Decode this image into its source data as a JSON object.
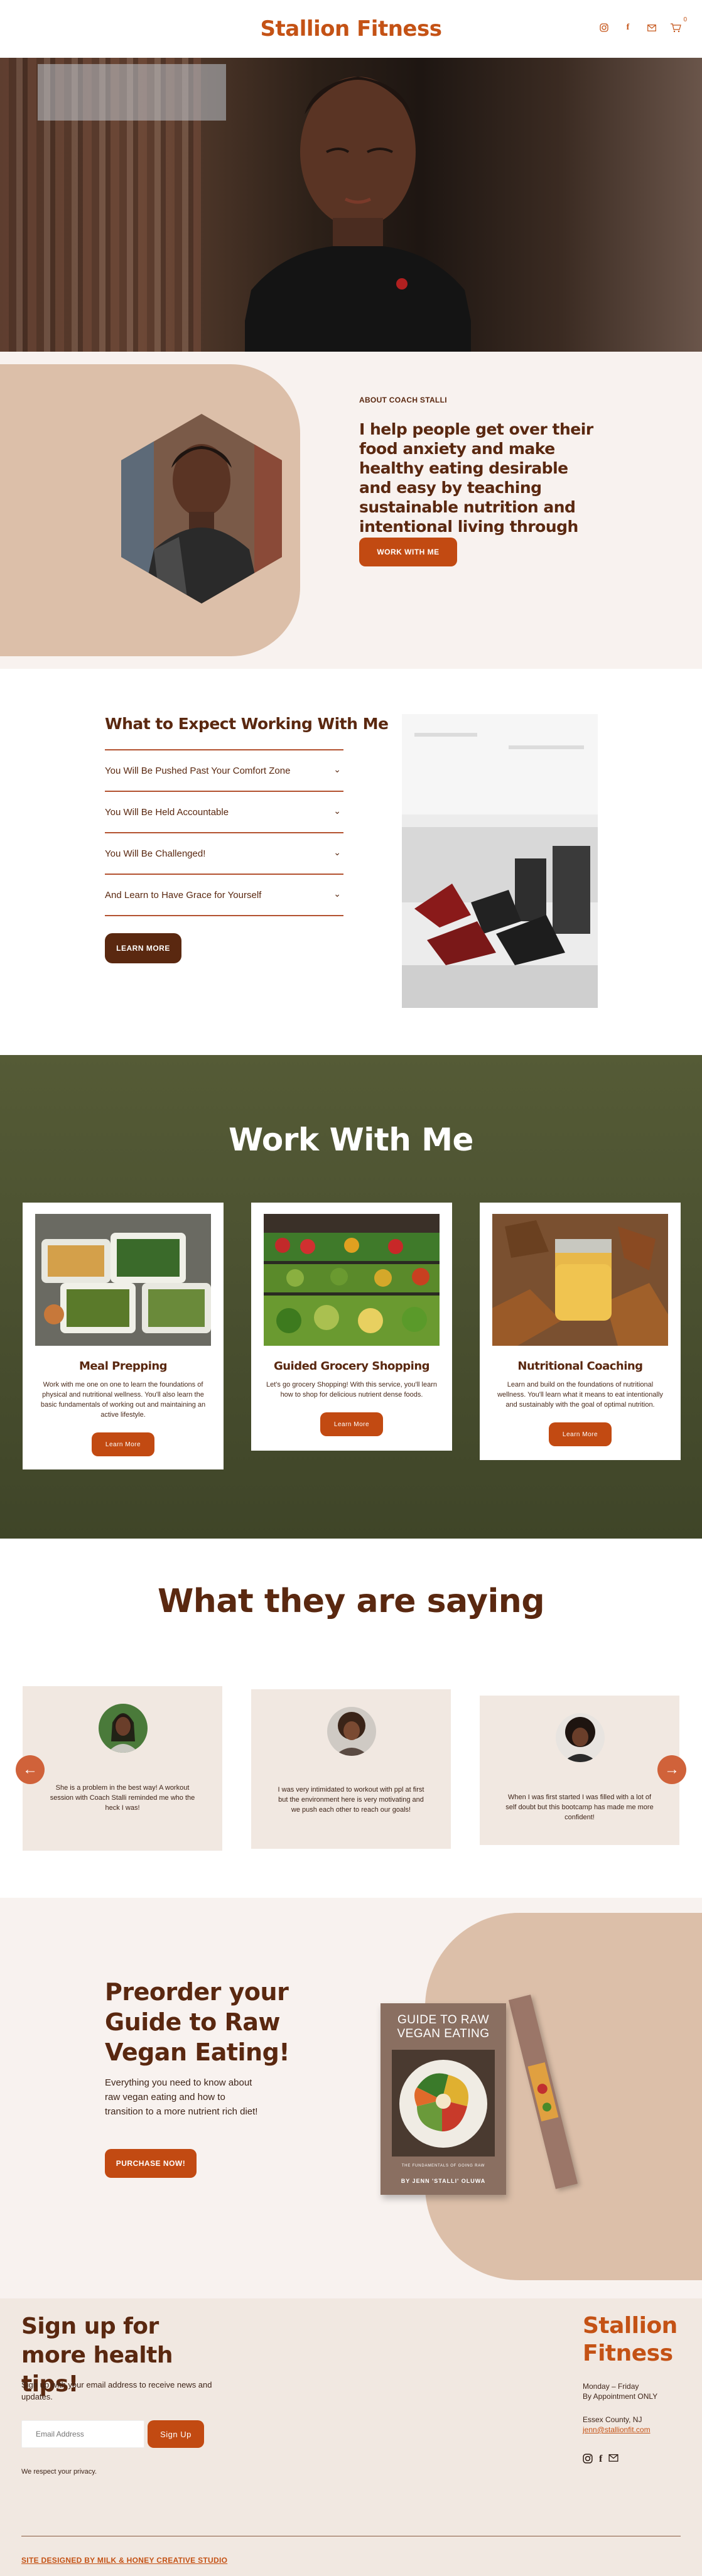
{
  "header": {
    "brand": "Stallion Fitness",
    "icons": [
      "instagram-icon",
      "facebook-icon",
      "mail-icon",
      "cart-icon"
    ],
    "cart_count": "0"
  },
  "about": {
    "kicker": "ABOUT COACH STALLI",
    "text": "I help people get over their food anxiety and make healthy eating desirable and easy by teaching sustainable nutrition and intentional living through fitness!",
    "button": "WORK WITH ME"
  },
  "expect": {
    "title": "What to Expect Working With Me",
    "items": [
      "You Will Be Pushed Past Your Comfort Zone",
      "You Will Be Held Accountable",
      "You Will Be Challenged!",
      "And Learn to Have Grace for Yourself"
    ],
    "button": "LEARN MORE"
  },
  "work": {
    "title": "Work With Me",
    "cards": [
      {
        "title": "Meal Prepping",
        "desc": "Work with me one on one to learn the foundations of physical and nutritional wellness. You'll also learn the basic fundamentals of working out and maintaining an active lifestyle.",
        "button": "Learn More"
      },
      {
        "title": "Guided Grocery Shopping",
        "desc": "Let's go grocery Shopping! With this service, you'll learn how to shop for delicious nutrient dense foods.",
        "button": "Learn More"
      },
      {
        "title": "Nutritional Coaching",
        "desc": "Learn and build on the foundations of nutritional wellness. You'll learn what it means to eat intentionally and sustainably with the goal of optimal nutrition.",
        "button": "Learn More"
      }
    ]
  },
  "testimonials": {
    "title": "What they are saying",
    "quotes": [
      "She is a problem in the best way! A workout session with Coach Stalli reminded me who the heck I was!",
      "I was very intimidated to workout with ppl at first but the environment here is very motivating and we push each other to reach our goals!",
      "When I was first started I was filled with a lot of self doubt but this bootcamp has made me more confident!"
    ],
    "prev": "←",
    "next": "→"
  },
  "preorder": {
    "title": "Preorder your Guide to Raw Vegan Eating!",
    "text": "Everything you need to know about raw vegan eating and how to transition to a more nutrient rich diet!",
    "button": "PURCHASE NOW!",
    "book_title": "GUIDE TO RAW VEGAN EATING",
    "book_subtitle": "THE FUNDAMENTALS OF GOING RAW",
    "book_author": "BY JENN 'STALLI' OLUWA"
  },
  "footer": {
    "signup_title": "Sign up for more health tips!",
    "signup_text": "Sign up with your email address to receive news and updates.",
    "email_placeholder": "Email Address",
    "signup_button": "Sign Up",
    "privacy": "We respect your privacy.",
    "brand": "Stallion Fitness",
    "hours_days": "Monday – Friday",
    "hours_note": "By Appointment ONLY",
    "location": "Essex County, NJ",
    "email": "jenn@stallionfit.com",
    "credit": "SITE DESIGNED BY MILK & HONEY CREATIVE STUDIO"
  },
  "colors": {
    "brand_orange": "#c45215",
    "button_orange": "#c24a12",
    "dark_brown": "#5a2810",
    "olive": "#4a5030",
    "tan": "#dcbfa9",
    "cream": "#f8f2ef"
  }
}
